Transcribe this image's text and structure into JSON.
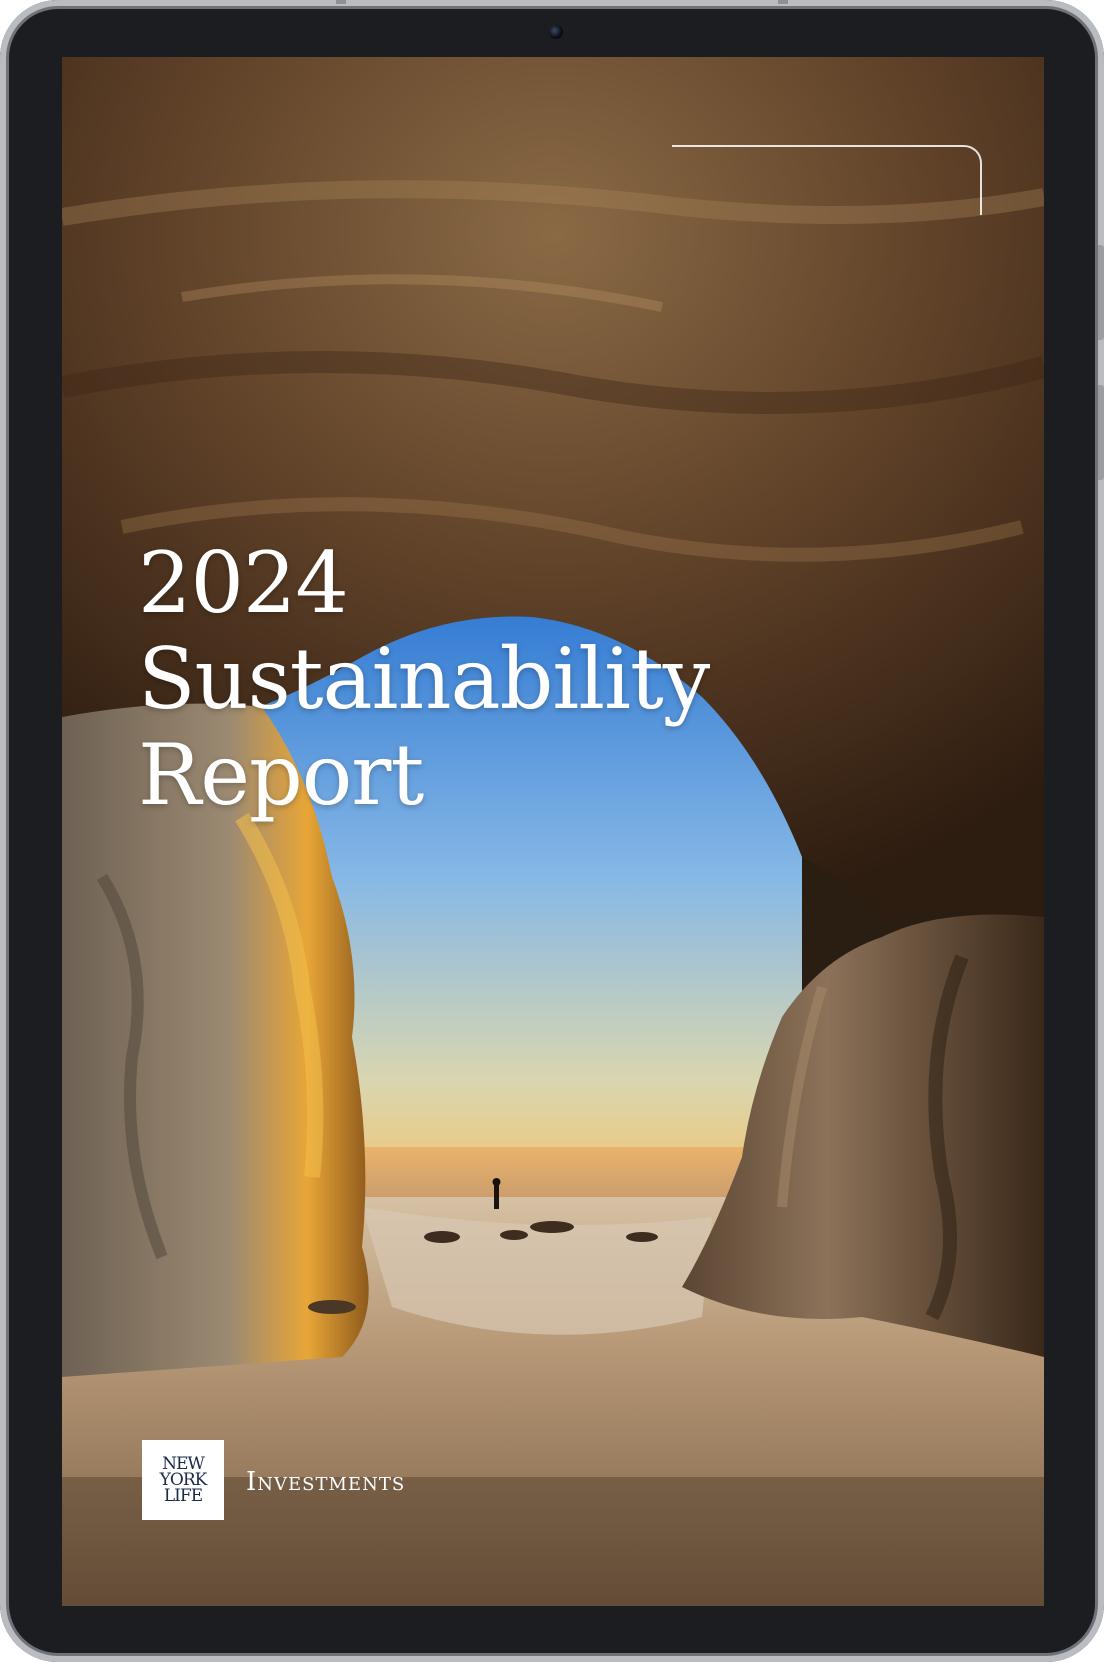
{
  "device": {
    "frame_color": "#1b1d20",
    "bezel_color": "#b9bcc0",
    "camera": "front-camera-icon"
  },
  "report": {
    "title_line_1": "2024",
    "title_line_2": "Sustainability",
    "title_line_3": "Report"
  },
  "brand": {
    "logo_line_1": "NEW",
    "logo_line_2": "YORK",
    "logo_line_3": "LIFE",
    "wordmark": "Investments"
  },
  "colors": {
    "sky_top": "#3f86d8",
    "sky_bottom": "#f3c66a",
    "rock": "#6b4a2c",
    "sand": "#a58463"
  }
}
